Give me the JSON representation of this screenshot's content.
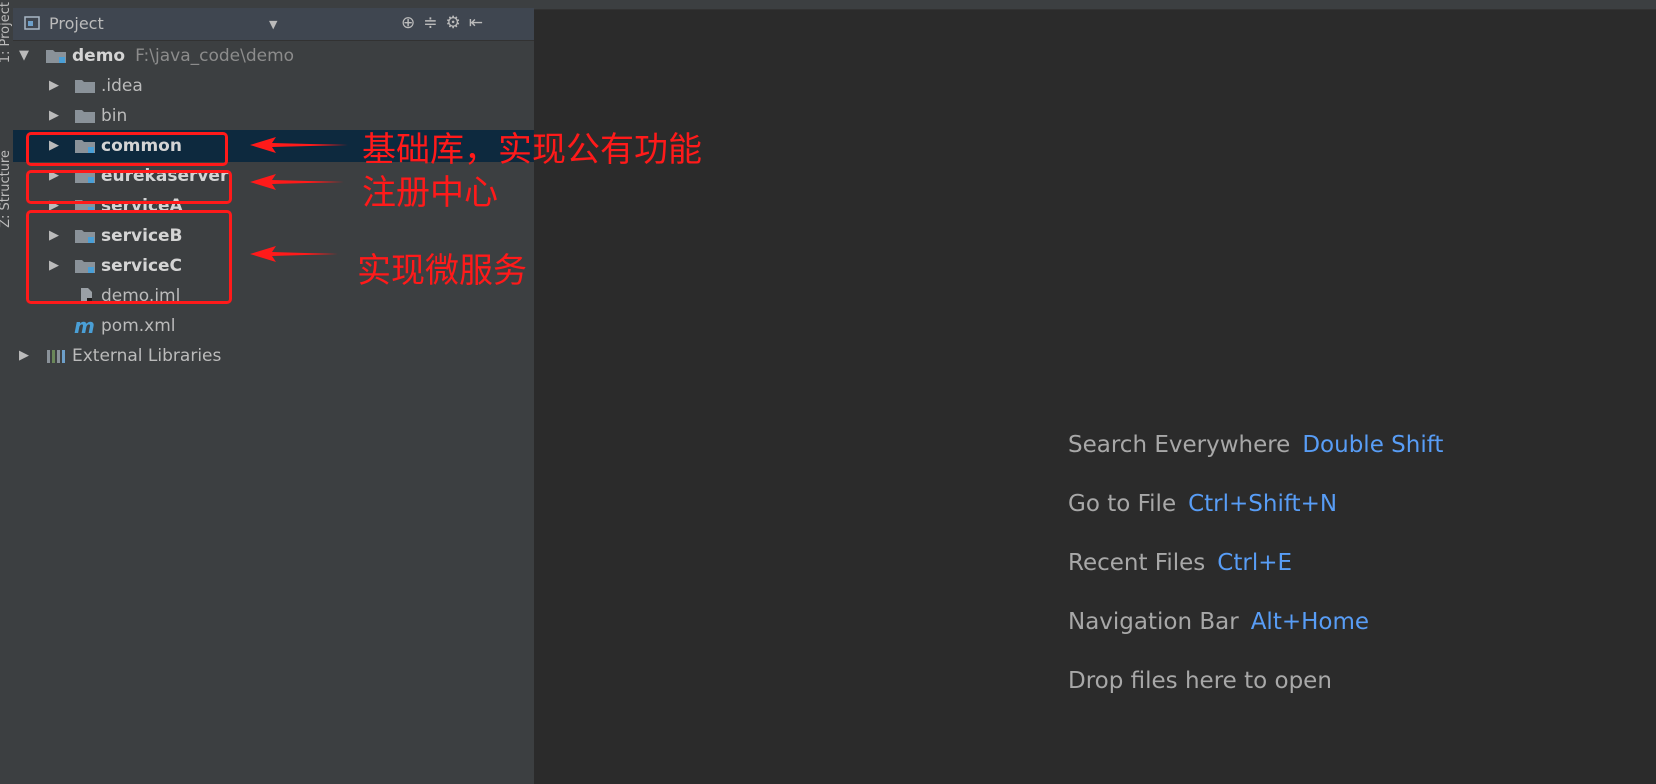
{
  "sidebar_strip": {
    "project_tab": "1: Project",
    "structure_tab": "Z: Structure"
  },
  "panel": {
    "title": "Project",
    "tree": [
      {
        "label": "demo",
        "path": "F:\\java_code\\demo",
        "expanded": true,
        "bold": true,
        "icon": "module-folder-icon"
      },
      {
        "label": ".idea",
        "icon": "folder-icon"
      },
      {
        "label": "bin",
        "icon": "folder-icon"
      },
      {
        "label": "common",
        "bold": true,
        "selected": true,
        "icon": "module-folder-icon"
      },
      {
        "label": "eurekaserver",
        "bold": true,
        "icon": "module-folder-icon"
      },
      {
        "label": "serviceA",
        "bold": true,
        "icon": "module-folder-icon"
      },
      {
        "label": "serviceB",
        "bold": true,
        "icon": "module-folder-icon"
      },
      {
        "label": "serviceC",
        "bold": true,
        "icon": "module-folder-icon"
      },
      {
        "label": "demo.iml",
        "icon": "iml-file-icon"
      },
      {
        "label": "pom.xml",
        "icon": "maven-icon"
      },
      {
        "label": "External Libraries",
        "icon": "libraries-icon"
      }
    ]
  },
  "annotations": {
    "common": "基础库，实现公有功能",
    "eureka": "注册中心",
    "services": "实现微服务"
  },
  "editor_hints": [
    {
      "text": "Search Everywhere",
      "shortcut": "Double Shift"
    },
    {
      "text": "Go to File",
      "shortcut": "Ctrl+Shift+N"
    },
    {
      "text": "Recent Files",
      "shortcut": "Ctrl+E"
    },
    {
      "text": "Navigation Bar",
      "shortcut": "Alt+Home"
    },
    {
      "text": "Drop files here to open",
      "shortcut": ""
    }
  ],
  "colors": {
    "accent": "#589df6",
    "annotation": "#ff1a1a",
    "selection": "#0d293e"
  }
}
